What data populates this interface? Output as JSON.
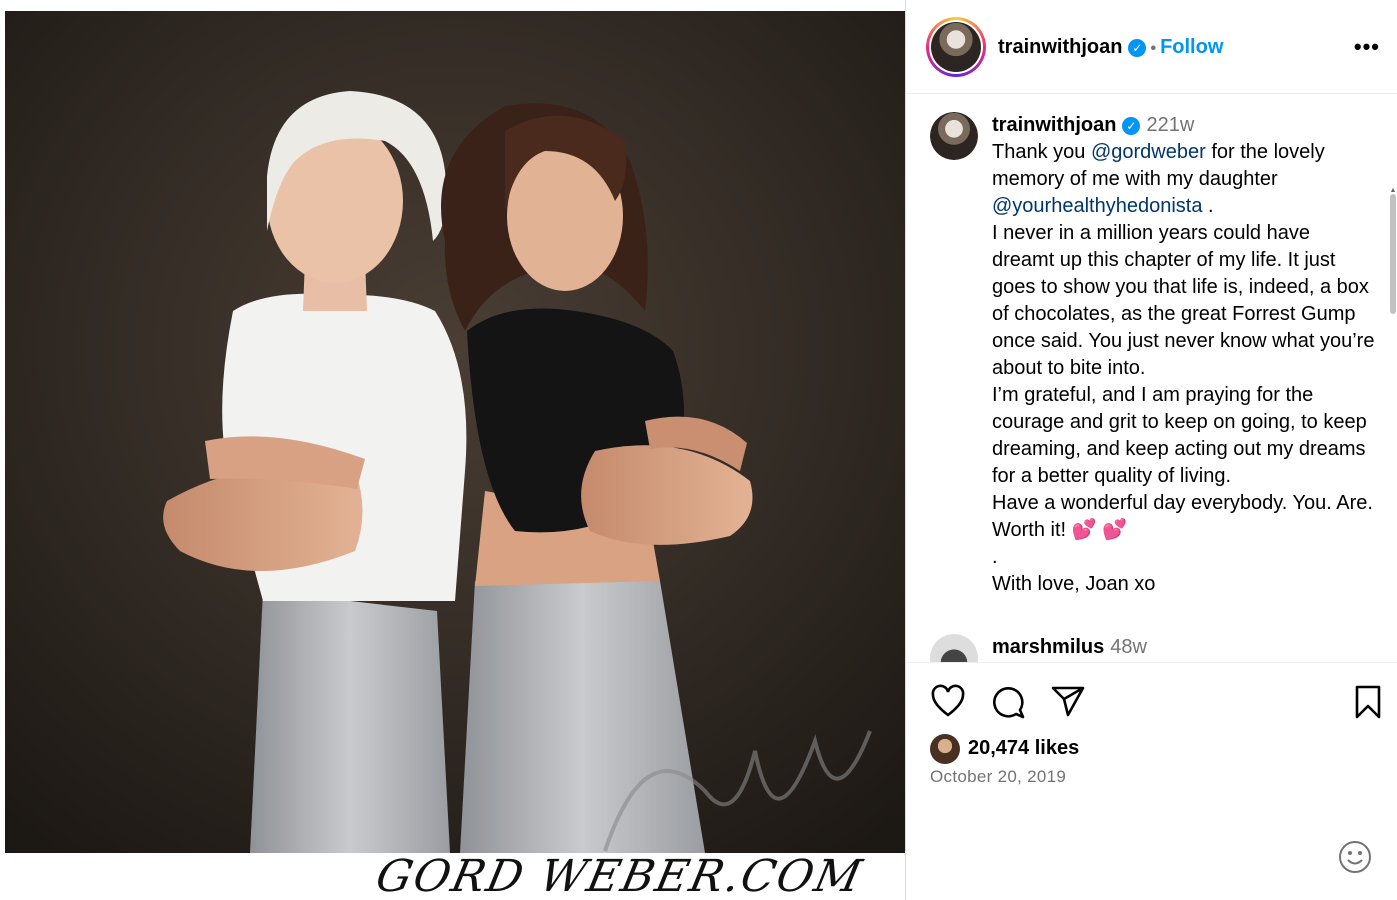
{
  "post": {
    "watermark": "GORD WEBER.COM"
  },
  "header": {
    "username": "trainwithjoan",
    "verified_icon": "verified-badge-icon",
    "separator": "•",
    "follow_label": "Follow",
    "more_label": "•••"
  },
  "caption": {
    "username": "trainwithjoan",
    "time": "221w",
    "line1_prefix": "Thank you ",
    "mention1": "@gordweber",
    "line1_suffix": " for the lovely memory of me with my daughter ",
    "mention2": "@yourhealthyhedonista",
    "line1_end": " .",
    "para2": "I never in a million years could have dreamt up this chapter of my life. It just goes to show you that life is, indeed, a box of chocolates, as the great Forrest Gump once said. You just never know what you’re about to bite into.",
    "para3": "I’m grateful, and I am praying for the courage and grit to keep on going, to keep dreaming, and keep acting out my dreams for a better quality of living.",
    "para4": "Have a wonderful day everybody. You. Are. Worth it! 💕 💕",
    "para5": ".",
    "para6": "With love, Joan xo"
  },
  "comment1": {
    "username": "marshmilus",
    "time": "48w"
  },
  "actions": {
    "like_icon": "heart-icon",
    "comment_icon": "comment-icon",
    "share_icon": "share-icon",
    "save_icon": "bookmark-icon"
  },
  "likes": {
    "text": "20,474 likes"
  },
  "date": "October 20, 2019",
  "emoji_icon": "emoji-smile-icon",
  "colors": {
    "accent": "#0095f6",
    "mention": "#00376b",
    "muted": "#737373"
  }
}
